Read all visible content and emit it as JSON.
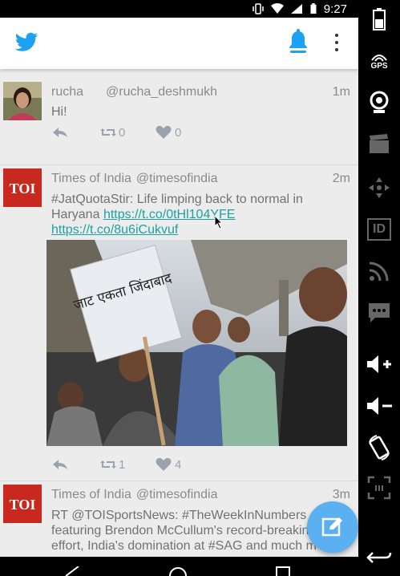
{
  "status_bar": {
    "time": "9:27"
  },
  "app": {
    "brand_color": "#1da1f2",
    "accent_color": "#1da1f2",
    "link_color": "#1da1a1"
  },
  "tweets": [
    {
      "name": "rucha",
      "handle": "@rucha_deshmukh",
      "time": "1m",
      "text": "Hi!",
      "retweets": "0",
      "likes": "0"
    },
    {
      "name": "Times of India",
      "handle": "@timesofindia",
      "time": "2m",
      "text": "#JatQuotaStir: Life limping back to normal in Haryana",
      "link1": "https://t.co/0tHl104YFE",
      "link2": "https://t.co/8u6iCukvuf",
      "retweets": "1",
      "likes": "4",
      "avatar_text": "TOI",
      "media_sign_text": "जाट एकता जिंदाबाद"
    },
    {
      "name": "Times of India",
      "handle": "@timesofindia",
      "time": "3m",
      "text": "RT @TOISportsNews: #TheWeekInNumbers featuring Brendon McCullum's record-breaking effort, India's domination at #SAG and much m",
      "avatar_text": "TOI"
    }
  ],
  "side_panel": {
    "gps_label": "GPS",
    "id_label": "ID"
  }
}
